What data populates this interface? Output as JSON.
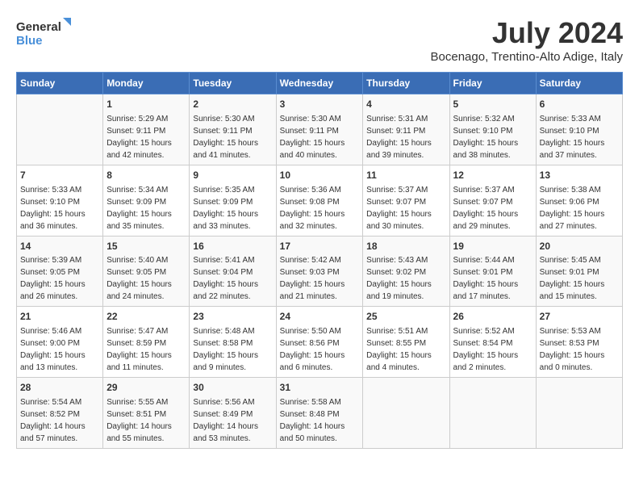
{
  "logo": {
    "line1": "General",
    "line2": "Blue"
  },
  "title": "July 2024",
  "subtitle": "Bocenago, Trentino-Alto Adige, Italy",
  "headers": [
    "Sunday",
    "Monday",
    "Tuesday",
    "Wednesday",
    "Thursday",
    "Friday",
    "Saturday"
  ],
  "weeks": [
    [
      {
        "day": "",
        "info": ""
      },
      {
        "day": "1",
        "info": "Sunrise: 5:29 AM\nSunset: 9:11 PM\nDaylight: 15 hours\nand 42 minutes."
      },
      {
        "day": "2",
        "info": "Sunrise: 5:30 AM\nSunset: 9:11 PM\nDaylight: 15 hours\nand 41 minutes."
      },
      {
        "day": "3",
        "info": "Sunrise: 5:30 AM\nSunset: 9:11 PM\nDaylight: 15 hours\nand 40 minutes."
      },
      {
        "day": "4",
        "info": "Sunrise: 5:31 AM\nSunset: 9:11 PM\nDaylight: 15 hours\nand 39 minutes."
      },
      {
        "day": "5",
        "info": "Sunrise: 5:32 AM\nSunset: 9:10 PM\nDaylight: 15 hours\nand 38 minutes."
      },
      {
        "day": "6",
        "info": "Sunrise: 5:33 AM\nSunset: 9:10 PM\nDaylight: 15 hours\nand 37 minutes."
      }
    ],
    [
      {
        "day": "7",
        "info": "Sunrise: 5:33 AM\nSunset: 9:10 PM\nDaylight: 15 hours\nand 36 minutes."
      },
      {
        "day": "8",
        "info": "Sunrise: 5:34 AM\nSunset: 9:09 PM\nDaylight: 15 hours\nand 35 minutes."
      },
      {
        "day": "9",
        "info": "Sunrise: 5:35 AM\nSunset: 9:09 PM\nDaylight: 15 hours\nand 33 minutes."
      },
      {
        "day": "10",
        "info": "Sunrise: 5:36 AM\nSunset: 9:08 PM\nDaylight: 15 hours\nand 32 minutes."
      },
      {
        "day": "11",
        "info": "Sunrise: 5:37 AM\nSunset: 9:07 PM\nDaylight: 15 hours\nand 30 minutes."
      },
      {
        "day": "12",
        "info": "Sunrise: 5:37 AM\nSunset: 9:07 PM\nDaylight: 15 hours\nand 29 minutes."
      },
      {
        "day": "13",
        "info": "Sunrise: 5:38 AM\nSunset: 9:06 PM\nDaylight: 15 hours\nand 27 minutes."
      }
    ],
    [
      {
        "day": "14",
        "info": "Sunrise: 5:39 AM\nSunset: 9:05 PM\nDaylight: 15 hours\nand 26 minutes."
      },
      {
        "day": "15",
        "info": "Sunrise: 5:40 AM\nSunset: 9:05 PM\nDaylight: 15 hours\nand 24 minutes."
      },
      {
        "day": "16",
        "info": "Sunrise: 5:41 AM\nSunset: 9:04 PM\nDaylight: 15 hours\nand 22 minutes."
      },
      {
        "day": "17",
        "info": "Sunrise: 5:42 AM\nSunset: 9:03 PM\nDaylight: 15 hours\nand 21 minutes."
      },
      {
        "day": "18",
        "info": "Sunrise: 5:43 AM\nSunset: 9:02 PM\nDaylight: 15 hours\nand 19 minutes."
      },
      {
        "day": "19",
        "info": "Sunrise: 5:44 AM\nSunset: 9:01 PM\nDaylight: 15 hours\nand 17 minutes."
      },
      {
        "day": "20",
        "info": "Sunrise: 5:45 AM\nSunset: 9:01 PM\nDaylight: 15 hours\nand 15 minutes."
      }
    ],
    [
      {
        "day": "21",
        "info": "Sunrise: 5:46 AM\nSunset: 9:00 PM\nDaylight: 15 hours\nand 13 minutes."
      },
      {
        "day": "22",
        "info": "Sunrise: 5:47 AM\nSunset: 8:59 PM\nDaylight: 15 hours\nand 11 minutes."
      },
      {
        "day": "23",
        "info": "Sunrise: 5:48 AM\nSunset: 8:58 PM\nDaylight: 15 hours\nand 9 minutes."
      },
      {
        "day": "24",
        "info": "Sunrise: 5:50 AM\nSunset: 8:56 PM\nDaylight: 15 hours\nand 6 minutes."
      },
      {
        "day": "25",
        "info": "Sunrise: 5:51 AM\nSunset: 8:55 PM\nDaylight: 15 hours\nand 4 minutes."
      },
      {
        "day": "26",
        "info": "Sunrise: 5:52 AM\nSunset: 8:54 PM\nDaylight: 15 hours\nand 2 minutes."
      },
      {
        "day": "27",
        "info": "Sunrise: 5:53 AM\nSunset: 8:53 PM\nDaylight: 15 hours\nand 0 minutes."
      }
    ],
    [
      {
        "day": "28",
        "info": "Sunrise: 5:54 AM\nSunset: 8:52 PM\nDaylight: 14 hours\nand 57 minutes."
      },
      {
        "day": "29",
        "info": "Sunrise: 5:55 AM\nSunset: 8:51 PM\nDaylight: 14 hours\nand 55 minutes."
      },
      {
        "day": "30",
        "info": "Sunrise: 5:56 AM\nSunset: 8:49 PM\nDaylight: 14 hours\nand 53 minutes."
      },
      {
        "day": "31",
        "info": "Sunrise: 5:58 AM\nSunset: 8:48 PM\nDaylight: 14 hours\nand 50 minutes."
      },
      {
        "day": "",
        "info": ""
      },
      {
        "day": "",
        "info": ""
      },
      {
        "day": "",
        "info": ""
      }
    ]
  ]
}
